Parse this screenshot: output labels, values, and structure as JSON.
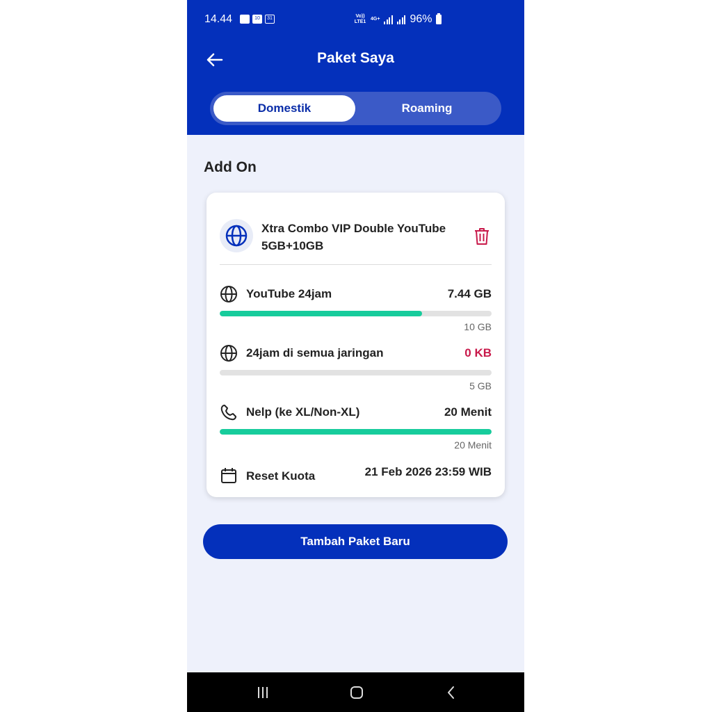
{
  "status_bar": {
    "time": "14.44",
    "net_label_1": "Vo)) LTE1",
    "net_label_2": "4G+",
    "battery": "96%"
  },
  "header": {
    "title": "Paket Saya",
    "back_icon": "arrow-left-icon"
  },
  "tabs": [
    {
      "label": "Domestik",
      "active": true
    },
    {
      "label": "Roaming",
      "active": false
    }
  ],
  "section": {
    "title": "Add On"
  },
  "package": {
    "name": "Xtra Combo VIP Double YouTube 5GB+10GB",
    "icon": "globe-icon",
    "delete_icon": "trash-icon",
    "quotas": [
      {
        "icon": "globe-icon",
        "label": "YouTube 24jam",
        "value": "7.44 GB",
        "total": "10 GB",
        "fraction": 0.744,
        "value_color": "#222222"
      },
      {
        "icon": "globe-icon",
        "label": "24jam di semua jaringan",
        "value": "0 KB",
        "total": "5 GB",
        "fraction": 0.0,
        "value_color": "#c8194a"
      },
      {
        "icon": "phone-icon",
        "label": "Nelp (ke XL/Non-XL)",
        "value": "20 Menit",
        "total": "20 Menit",
        "fraction": 1.0,
        "value_color": "#222222"
      }
    ],
    "reset": {
      "icon": "calendar-icon",
      "label": "Reset Kuota",
      "value": "21 Feb 2026 23:59 WIB"
    }
  },
  "actions": {
    "add_package": "Tambah Paket Baru"
  },
  "colors": {
    "brand": "#0430bb",
    "progress": "#17cc9c",
    "danger": "#c8194a"
  },
  "nav": {
    "recent_icon": "recent-apps-icon",
    "home_icon": "home-icon",
    "back_icon": "back-icon"
  }
}
